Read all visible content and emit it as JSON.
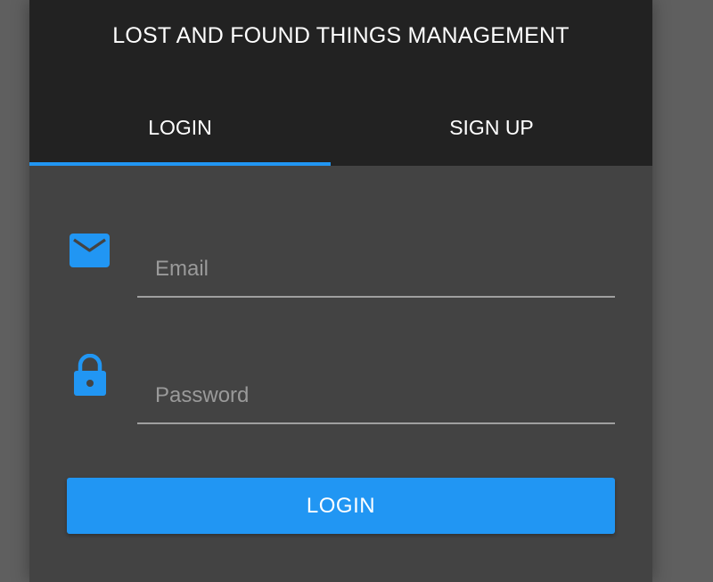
{
  "app": {
    "title": "LOST AND FOUND THINGS MANAGEMENT"
  },
  "tabs": [
    {
      "label": "LOGIN",
      "active": true
    },
    {
      "label": "SIGN UP",
      "active": false
    }
  ],
  "form": {
    "email": {
      "placeholder": "Email",
      "value": "",
      "icon": "mail-icon"
    },
    "password": {
      "placeholder": "Password",
      "value": "",
      "icon": "lock-icon"
    },
    "submit_label": "LOGIN"
  },
  "colors": {
    "accent": "#2196f3",
    "header_bg": "#222222",
    "card_bg": "#434343",
    "page_bg": "#5f5f5f"
  }
}
